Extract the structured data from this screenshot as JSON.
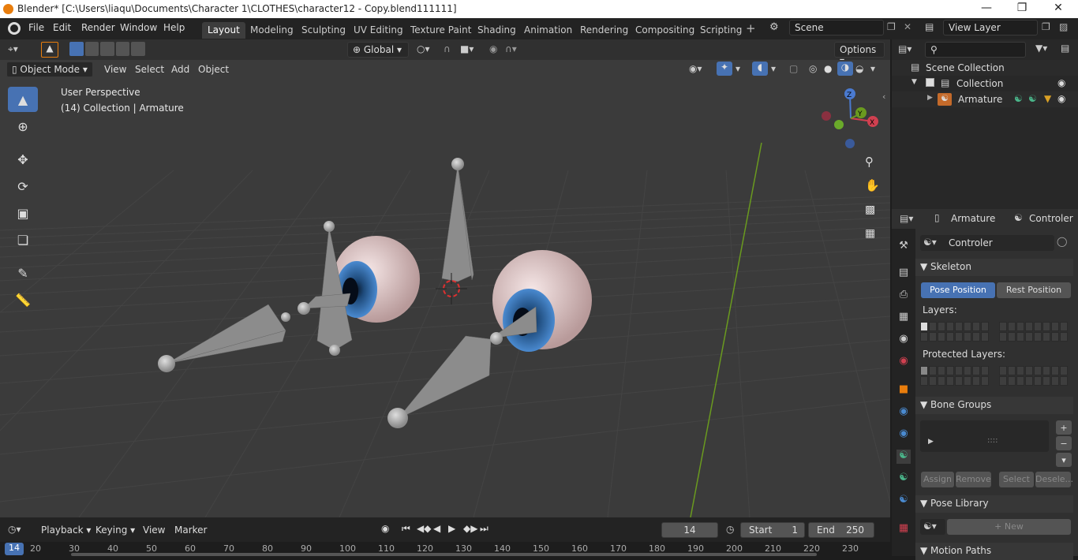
{
  "title": "Blender* [C:\\Users\\liaqu\\Documents\\Character 1\\CLOTHES\\character12 - Copy.blend111111]",
  "menus": [
    "File",
    "Edit",
    "Render",
    "Window",
    "Help"
  ],
  "workspaces": [
    "Layout",
    "Modeling",
    "Sculpting",
    "UV Editing",
    "Texture Paint",
    "Shading",
    "Animation",
    "Rendering",
    "Compositing",
    "Scripting"
  ],
  "scene": "Scene",
  "view_layer": "View Layer",
  "header": {
    "transform": "Global",
    "options": "Options",
    "mode": "Object Mode",
    "view": "View",
    "select": "Select",
    "add": "Add",
    "object": "Object"
  },
  "viewport": {
    "perspective": "User Perspective",
    "collection_info": "(14) Collection | Armature"
  },
  "outliner": {
    "scene_collection": "Scene Collection",
    "collection": "Collection",
    "armature": "Armature"
  },
  "props": {
    "obj": "Armature",
    "data": "Controler",
    "datablock": "Controler",
    "skeleton": "Skeleton",
    "pose_position": "Pose Position",
    "rest_position": "Rest Position",
    "layers": "Layers:",
    "protected_layers": "Protected Layers:",
    "bone_groups": "Bone Groups",
    "assign": "Assign",
    "remove": "Remove",
    "select": "Select",
    "deselect": "Desele...",
    "pose_library": "Pose Library",
    "new": "New",
    "motion_paths": "Motion Paths"
  },
  "timeline": {
    "playback": "Playback",
    "keying": "Keying",
    "view": "View",
    "marker": "Marker",
    "current_frame": "14",
    "start_label": "Start",
    "start": "1",
    "end_label": "End",
    "end": "250",
    "ticks": [
      "20",
      "30",
      "40",
      "50",
      "60",
      "70",
      "80",
      "90",
      "100",
      "110",
      "120",
      "130",
      "140",
      "150",
      "160",
      "170",
      "180",
      "190",
      "200",
      "210",
      "220",
      "230"
    ]
  },
  "colors": {
    "accent": "#4772b3",
    "brand": "#e87d0d",
    "axis_y": "#6a9a1f"
  }
}
